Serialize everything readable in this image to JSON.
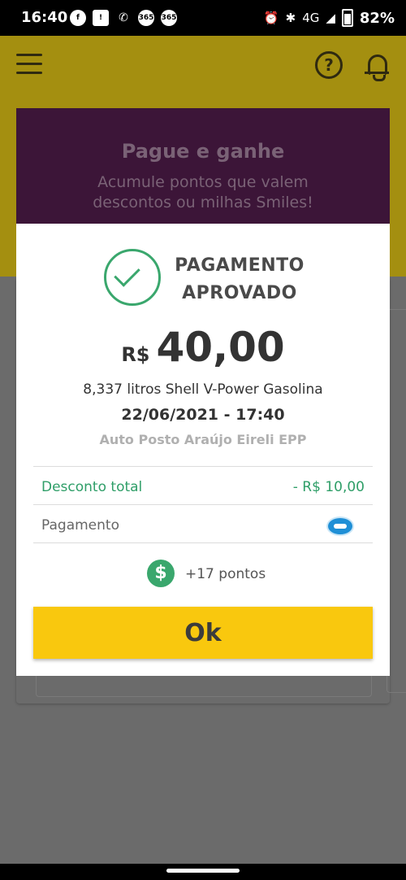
{
  "status_bar": {
    "time": "16:40",
    "left_icons": [
      "facebook-icon",
      "app-icon",
      "phone-icon",
      "365-icon",
      "365-icon"
    ],
    "left_icon_labels": [
      "f",
      "!",
      "✆",
      "365",
      "365"
    ],
    "network": "4G",
    "battery": "82%"
  },
  "app_bar": {
    "help_symbol": "?"
  },
  "promo": {
    "title": "Pague e ganhe",
    "subtitle_line1": "Acumule pontos que valem",
    "subtitle_line2": "descontos ou milhas Smiles!"
  },
  "dialog": {
    "status_line1": "PAGAMENTO",
    "status_line2": "APROVADO",
    "currency": "R$",
    "amount": "40,00",
    "product": "8,337 litros Shell V-Power Gasolina",
    "datetime": "22/06/2021 - 17:40",
    "station": "Auto Posto Araújo Eireli EPP",
    "discount_label": "Desconto total",
    "discount_value": "- R$ 10,00",
    "payment_label": "Pagamento",
    "coin_symbol": "$",
    "points": "+17 pontos",
    "ok_label": "Ok"
  },
  "colors": {
    "accent_yellow": "#f9c80e",
    "success_green": "#3aa76d",
    "promo_purple": "#3c1538"
  }
}
